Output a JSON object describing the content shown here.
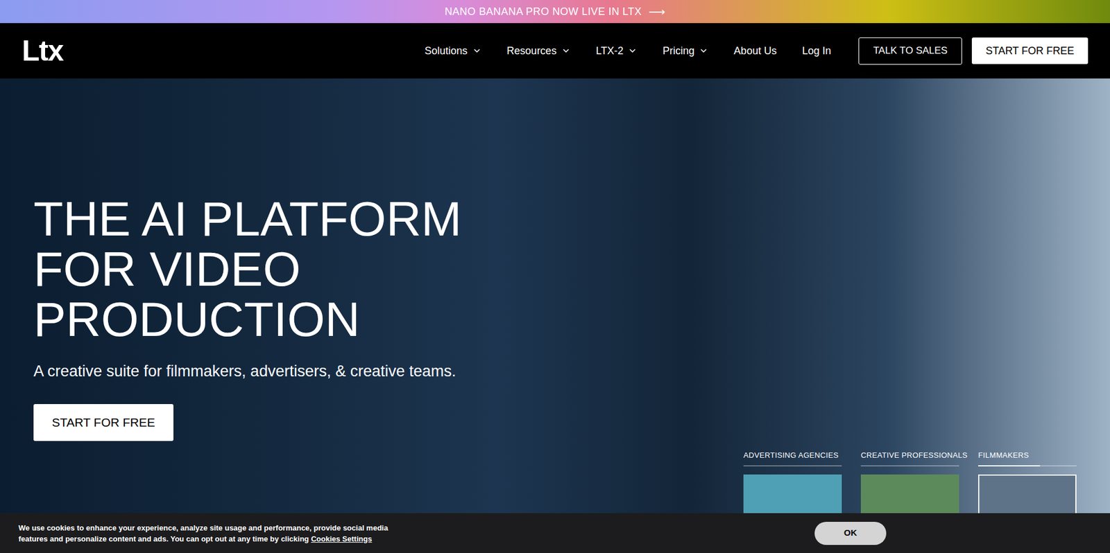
{
  "banner": {
    "text": "NANO BANANA PRO NOW LIVE IN LTX",
    "arrow": "⟶"
  },
  "nav": {
    "logo": "Ltx",
    "items": [
      {
        "label": "Solutions",
        "dropdown": true
      },
      {
        "label": "Resources",
        "dropdown": true
      },
      {
        "label": "LTX-2",
        "dropdown": true
      },
      {
        "label": "Pricing",
        "dropdown": true
      },
      {
        "label": "About Us",
        "dropdown": false
      },
      {
        "label": "Log In",
        "dropdown": false
      }
    ],
    "buttons": [
      {
        "label": "TALK TO SALES",
        "kind": "outline"
      },
      {
        "label": "START FOR FREE",
        "kind": "solid"
      }
    ]
  },
  "hero": {
    "title_lines": [
      "THE AI PLATFORM",
      "FOR VIDEO",
      "PRODUCTION"
    ],
    "subtitle": "A creative suite for filmmakers, advertisers, & creative teams.",
    "cta": "START FOR FREE",
    "tabs": [
      {
        "label": "ADVERTISING AGENCIES",
        "selected": false,
        "level": 0,
        "color": "#4f9fb5"
      },
      {
        "label": "CREATIVE PROFESSIONALS",
        "selected": false,
        "level": 0,
        "color": "#5d8a5a"
      },
      {
        "label": "FILMMAKERS",
        "selected": true,
        "level": 0.63,
        "color": "#5f7388"
      }
    ]
  },
  "cookie": {
    "text": "We use cookies to enhance your experience, analyze site usage and performance, provide social media features and personalize content and ads. You can opt out at any time by clicking",
    "link": "Cookies Settings",
    "button": "OK"
  }
}
